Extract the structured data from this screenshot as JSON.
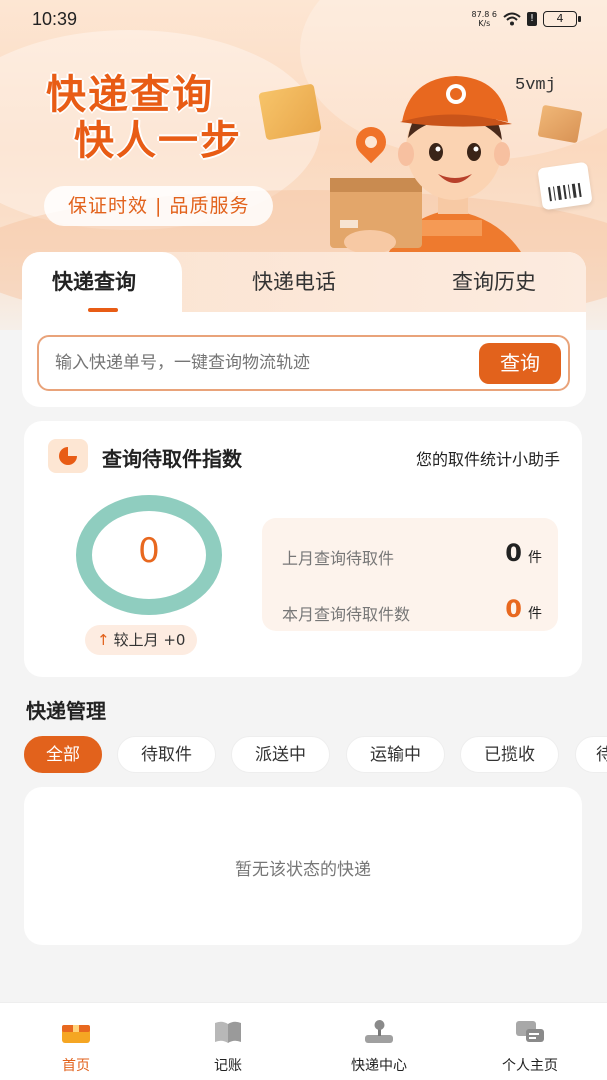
{
  "status_bar": {
    "time": "10:39",
    "speed_value": "87.8",
    "speed_exp": "6",
    "speed_unit": "K/s",
    "battery": "4"
  },
  "hero": {
    "title_line1": "快递查询",
    "title_line2": "快人一步",
    "subtitle": "保证时效 | 品质服务",
    "code": "5vmj"
  },
  "tabs": [
    {
      "label": "快递查询",
      "active": true
    },
    {
      "label": "快递电话",
      "active": false
    },
    {
      "label": "查询历史",
      "active": false
    }
  ],
  "search": {
    "placeholder": "输入快递单号，一键查询物流轨迹",
    "button_label": "查询"
  },
  "index_card": {
    "title": "查询待取件指数",
    "subtitle": "您的取件统计小助手",
    "ring_value": "0",
    "compare_text": "较上月 +0",
    "stats": [
      {
        "label": "上月查询待取件",
        "value": "0",
        "unit": "件"
      },
      {
        "label": "本月查询待取件数",
        "value": "0",
        "unit": "件"
      }
    ]
  },
  "management": {
    "title": "快递管理",
    "chips": [
      "全部",
      "待取件",
      "派送中",
      "运输中",
      "已揽收",
      "待"
    ],
    "active_chip": "全部",
    "empty_text": "暂无该状态的快递"
  },
  "bottom_nav": [
    {
      "label": "首页",
      "icon": "home-box-icon",
      "active": true
    },
    {
      "label": "记账",
      "icon": "book-icon",
      "active": false
    },
    {
      "label": "快递中心",
      "icon": "joystick-icon",
      "active": false
    },
    {
      "label": "个人主页",
      "icon": "chat-bubbles-icon",
      "active": false
    }
  ],
  "colors": {
    "accent": "#e2621c",
    "ring": "#8fcdbf",
    "background": "#f4f4f4"
  }
}
